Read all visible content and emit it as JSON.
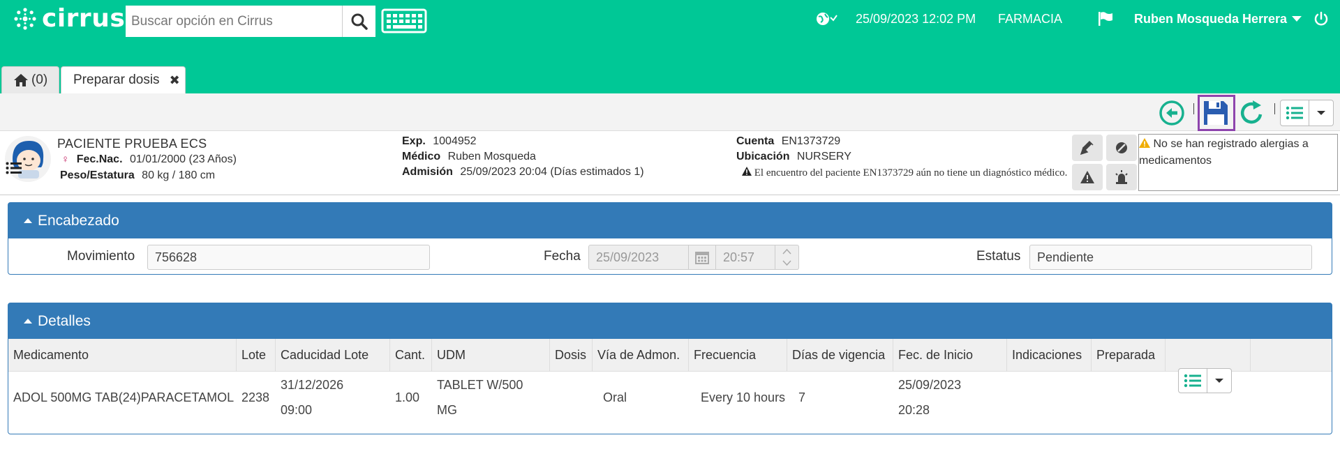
{
  "colors": {
    "brand": "#00c896",
    "panel": "#337ab7",
    "accent": "#17b18f",
    "highlight": "#8e44ad"
  },
  "app": {
    "name": "cirrus"
  },
  "search": {
    "placeholder": "Buscar opción en Cirrus",
    "value": ""
  },
  "header": {
    "datetime": "25/09/2023 12:02 PM",
    "area": "FARMACIA",
    "user": "Ruben Mosqueda Herrera"
  },
  "tabs": [
    {
      "label": "(0)",
      "icon": "home-icon"
    },
    {
      "label": "Preparar dosis",
      "close": "✖"
    }
  ],
  "toolbar": {
    "icons": [
      "back-icon",
      "save-icon",
      "refresh-icon",
      "list-icon",
      "caret-down-icon"
    ]
  },
  "patient": {
    "name": "PACIENTE PRUEBA ECS",
    "birth_label": "Fec.Nac.",
    "birth_value": "01/01/2000 (23 Años)",
    "weight_label": "Peso/Estatura",
    "weight_value": "80 kg / 180 cm",
    "exp_label": "Exp.",
    "exp_value": "1004952",
    "doctor_label": "Médico",
    "doctor_value": "Ruben Mosqueda",
    "admission_label": "Admisión",
    "admission_value": "25/09/2023 20:04 (Días estimados 1)",
    "account_label": "Cuenta",
    "account_value": "EN1373729",
    "location_label": "Ubicación",
    "location_value": "NURSERY",
    "warning": "El encuentro del paciente EN1373729 aún no tiene un diagnóstico médico.",
    "allergy": "No se han registrado alergias a medicamentos"
  },
  "encabezado": {
    "title": "Encabezado",
    "movimiento_label": "Movimiento",
    "movimiento_value": "756628",
    "fecha_label": "Fecha",
    "fecha_value": "25/09/2023",
    "hora_value": "20:57",
    "estatus_label": "Estatus",
    "estatus_value": "Pendiente"
  },
  "detalles": {
    "title": "Detalles",
    "columns": [
      "Medicamento",
      "Lote",
      "Caducidad Lote",
      "Cant.",
      "UDM",
      "Dosis",
      "Vía de Admon.",
      "Frecuencia",
      "Días de vigencia",
      "Fec. de Inicio",
      "Indicaciones",
      "Preparada"
    ],
    "rows": [
      {
        "medicamento": "ADOL 500MG TAB(24)PARACETAMOL",
        "lote": "2238",
        "caducidad_1": "31/12/2026",
        "caducidad_2": "09:00",
        "cant": "1.00",
        "udm_1": "TABLET W/500",
        "udm_2": "MG",
        "dosis": "",
        "via": "Oral",
        "frecuencia": "Every 10 hours",
        "dias": "7",
        "inicio_1": "25/09/2023",
        "inicio_2": "20:28",
        "indicaciones": "",
        "preparada": ""
      }
    ]
  }
}
